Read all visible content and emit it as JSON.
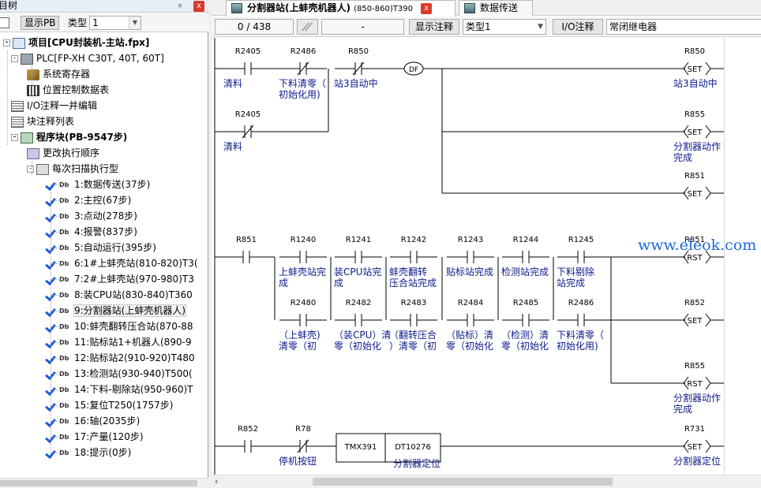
{
  "left_panel": {
    "title": "目树",
    "pin_glyph": "ᵖ",
    "close_glyph": "x",
    "toolbar": {
      "show_pb_button": "显示PB",
      "type_label": "类型",
      "type_value": "1"
    },
    "tree": [
      {
        "label": "项目[CPU封装机-主站.fpx]",
        "icon": "project-icon",
        "bold": true,
        "expand": "-"
      },
      {
        "label": "PLC[FP-XH C30T, 40T, 60T]",
        "icon": "plc-icon",
        "expand": "-"
      },
      {
        "label": "系统寄存器",
        "icon": "system-register-icon"
      },
      {
        "label": "位置控制数据表",
        "icon": "position-table-icon"
      },
      {
        "label": "I/O注释一并编辑",
        "icon": "io-comment-icon"
      },
      {
        "label": "块注释列表",
        "icon": "block-comment-icon"
      },
      {
        "label": "程序块(PB-9547步)",
        "icon": "program-block-icon",
        "bold": true,
        "expand": "-"
      },
      {
        "label": "更改执行顺序",
        "icon": "order-icon"
      },
      {
        "label": "每次扫描执行型",
        "icon": "scan-icon",
        "expand": "-"
      },
      {
        "label": "1:数据传送(37步)",
        "icon": "check-icon"
      },
      {
        "label": "2:主控(67步)",
        "icon": "check-icon"
      },
      {
        "label": "3:点动(278步)",
        "icon": "check-icon"
      },
      {
        "label": "4:报警(837步)",
        "icon": "check-icon"
      },
      {
        "label": "5:自动运行(395步)",
        "icon": "check-icon"
      },
      {
        "label": "6:1#上蚌壳站(810-820)T3(",
        "icon": "check-icon"
      },
      {
        "label": "7:2#上蚌壳站(970-980)T3",
        "icon": "check-icon"
      },
      {
        "label": "8:装CPU站(830-840)T360",
        "icon": "check-icon"
      },
      {
        "label": "9:分割器站(上蚌壳机器人)",
        "icon": "check-icon",
        "selected": true
      },
      {
        "label": "10:蚌壳翻转压合站(870-88",
        "icon": "check-icon"
      },
      {
        "label": "11:贴标站1+机器人(890-9",
        "icon": "check-icon"
      },
      {
        "label": "12:贴标站2(910-920)T480",
        "icon": "check-icon"
      },
      {
        "label": "13:检测站(930-940)T500(",
        "icon": "check-icon"
      },
      {
        "label": "14:下料-剔除站(950-960)T",
        "icon": "check-icon"
      },
      {
        "label": "15:复位T250(1757步)",
        "icon": "check-icon"
      },
      {
        "label": "16:轴(2035步)",
        "icon": "check-icon"
      },
      {
        "label": "17:产量(120步)",
        "icon": "check-icon"
      },
      {
        "label": "18:提示(0步)",
        "icon": "check-icon"
      }
    ],
    "db_tag": "Db"
  },
  "tabs": [
    {
      "title": "分割器站(上蚌壳机器人)",
      "subtitle": "(850-860)T390",
      "active": true,
      "close": "x"
    },
    {
      "title": "数据传送",
      "active": false
    }
  ],
  "toolbar2": {
    "step_counter": "0 /    438",
    "field_dash": "-",
    "show_comment_button": "显示注释",
    "type_select": "类型1",
    "io_comment_label": "I/O注释",
    "io_comment_value": "常闭继电器"
  },
  "ladder": {
    "rungs": [
      {
        "contacts": [
          {
            "addr": "R2405",
            "type": "NO",
            "comment": [
              "清料"
            ]
          },
          {
            "addr": "R2486",
            "type": "NC",
            "comment": [
              "下料清零（",
              "初始化用)"
            ]
          },
          {
            "addr": "R850",
            "type": "NC",
            "comment": [
              "站3自动中"
            ]
          },
          {
            "addr": "R2405",
            "type": "NC",
            "comment": [
              "清料"
            ],
            "branch": true
          }
        ],
        "function": "DF",
        "outputs": [
          {
            "addr": "R850",
            "instr": "SET",
            "comment": [
              "站3自动中"
            ]
          },
          {
            "addr": "R855",
            "instr": "SET",
            "comment": [
              "分割器动作",
              "完成"
            ]
          },
          {
            "addr": "R851",
            "instr": "SET",
            "comment": []
          }
        ]
      },
      {
        "contacts": [
          {
            "addr": "R851",
            "type": "NO",
            "comment": []
          },
          {
            "addr": "R1240",
            "type": "NO",
            "comment": [
              "上蚌壳站完",
              "成"
            ]
          },
          {
            "addr": "R1241",
            "type": "NO",
            "comment": [
              "装CPU站完",
              "成"
            ]
          },
          {
            "addr": "R1242",
            "type": "NO",
            "comment": [
              "蚌壳翻转",
              "压合站完成"
            ]
          },
          {
            "addr": "R1243",
            "type": "NO",
            "comment": [
              "贴标站完成"
            ]
          },
          {
            "addr": "R1244",
            "type": "NO",
            "comment": [
              "检测站完成"
            ]
          },
          {
            "addr": "R1245",
            "type": "NO",
            "comment": [
              "下料剔除",
              "站完成"
            ]
          },
          {
            "addr": "R2480",
            "type": "NO",
            "comment": [
              "（上蚌壳)",
              "清零（初"
            ]
          },
          {
            "addr": "R2482",
            "type": "NO",
            "comment": [
              "（装CPU）清",
              "零（初始化"
            ]
          },
          {
            "addr": "R2483",
            "type": "NO",
            "comment": [
              "（翻转压合",
              "）清零（初"
            ]
          },
          {
            "addr": "R2484",
            "type": "NO",
            "comment": [
              "（贴标）清",
              "零（初始化"
            ]
          },
          {
            "addr": "R2485",
            "type": "NO",
            "comment": [
              "（检测）清",
              "零（初始化"
            ]
          },
          {
            "addr": "R2486",
            "type": "NO",
            "comment": [
              "下料清零（",
              "初始化用)"
            ]
          }
        ],
        "outputs": [
          {
            "addr": "R851",
            "instr": "RST",
            "comment": []
          },
          {
            "addr": "R852",
            "instr": "SET",
            "comment": []
          },
          {
            "addr": "R855",
            "instr": "RST",
            "comment": [
              "分割器动作",
              "完成"
            ]
          }
        ]
      },
      {
        "contacts": [
          {
            "addr": "R852",
            "type": "NO",
            "comment": []
          },
          {
            "addr": "R78",
            "type": "NC",
            "comment": [
              "停机按钮"
            ]
          }
        ],
        "timer": {
          "name": "TMX391",
          "preset": "DT10276",
          "comment": "分割器定位"
        },
        "outputs": [
          {
            "addr": "R731",
            "instr": "SET",
            "comment": [
              "分割器定位"
            ]
          }
        ]
      }
    ]
  },
  "watermark": "www.eleok.com"
}
